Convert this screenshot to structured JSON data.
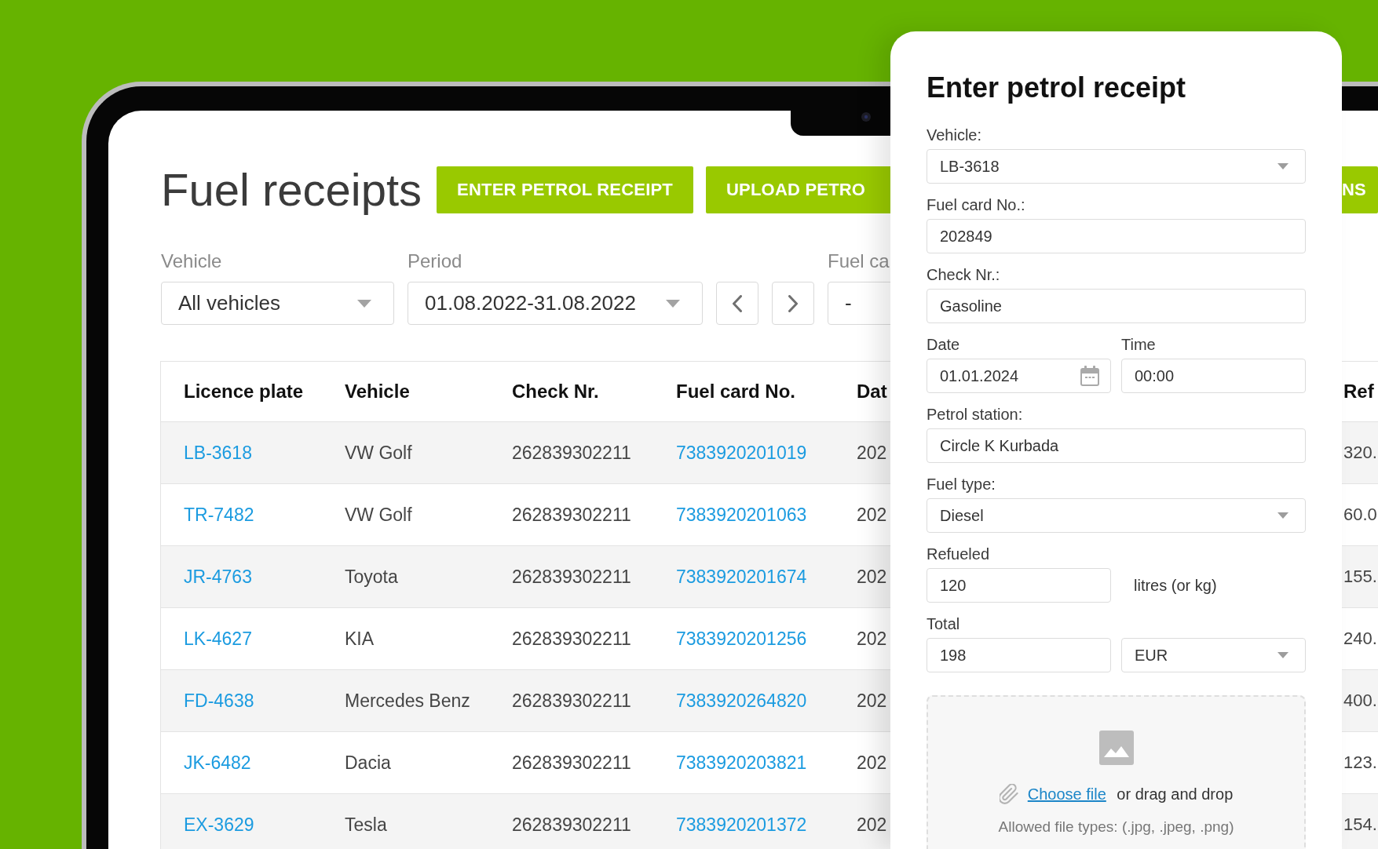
{
  "header": {
    "title": "Fuel receipts",
    "buttons": [
      {
        "label_parts": [
          "ENTER PETROL RECEIPT"
        ]
      },
      {
        "label_parts": [
          "UPLOAD PETRO",
          "NS"
        ]
      }
    ]
  },
  "filters": [
    {
      "kind": "select",
      "label": "Vehicle",
      "value": "All vehicles"
    },
    {
      "kind": "select",
      "label": "Period",
      "value": "01.08.2022-31.08.2022"
    },
    {
      "kind": "pager"
    },
    {
      "kind": "input",
      "label": "Fuel ca",
      "value": "-"
    }
  ],
  "table": {
    "columns": [
      {
        "label": "Licence plate",
        "kind": "link"
      },
      {
        "label": "Vehicle",
        "kind": "text"
      },
      {
        "label": "Check Nr.",
        "kind": "text"
      },
      {
        "label": "Fuel card No.",
        "kind": "link"
      },
      {
        "label": "Dat",
        "kind": "text"
      },
      {
        "label": "Ref",
        "kind": "text"
      }
    ],
    "rows": [
      {
        "cells": [
          "LB-3618",
          "VW Golf",
          "262839302211",
          "7383920201019",
          "202",
          "320."
        ]
      },
      {
        "cells": [
          "TR-7482",
          "VW Golf",
          "262839302211",
          "7383920201063",
          "202",
          "60.0"
        ]
      },
      {
        "cells": [
          "JR-4763",
          "Toyota",
          "262839302211",
          "7383920201674",
          "202",
          "155."
        ]
      },
      {
        "cells": [
          "LK-4627",
          "KIA",
          "262839302211",
          "7383920201256",
          "202",
          "240."
        ]
      },
      {
        "cells": [
          "FD-4638",
          "Mercedes Benz",
          "262839302211",
          "7383920264820",
          "202",
          "400."
        ]
      },
      {
        "cells": [
          "JK-6482",
          "Dacia",
          "262839302211",
          "7383920203821",
          "202",
          "123."
        ]
      },
      {
        "cells": [
          "EX-3629",
          "Tesla",
          "262839302211",
          "7383920201372",
          "202",
          "154."
        ]
      }
    ]
  },
  "receipt_form": {
    "title": "Enter petrol receipt",
    "rows": [
      {
        "fields": [
          {
            "kind": "select",
            "label": "Vehicle:",
            "value": "LB-3618"
          }
        ]
      },
      {
        "fields": [
          {
            "kind": "input",
            "label": "Fuel card No.:",
            "value": "202849"
          }
        ]
      },
      {
        "fields": [
          {
            "kind": "input",
            "label": "Check Nr.:",
            "value": "Gasoline"
          }
        ]
      },
      {
        "fields": [
          {
            "kind": "date",
            "label": "Date",
            "value": "01.01.2024"
          },
          {
            "kind": "input",
            "label": "Time",
            "value": "00:00"
          }
        ]
      },
      {
        "fields": [
          {
            "kind": "input",
            "label": "Petrol station:",
            "value": "Circle K Kurbada"
          }
        ]
      },
      {
        "fields": [
          {
            "kind": "select",
            "label": "Fuel type:",
            "value": "Diesel"
          }
        ]
      },
      {
        "label": "Refueled",
        "fields": [
          {
            "kind": "input",
            "value": "120"
          },
          {
            "kind": "unit",
            "text": "litres (or kg)"
          }
        ]
      },
      {
        "label": "Total",
        "fields": [
          {
            "kind": "input",
            "value": "198"
          },
          {
            "kind": "select",
            "value": "EUR"
          }
        ]
      }
    ],
    "upload": {
      "link": "Choose file",
      "prompt": "or drag and drop",
      "note": "Allowed file types: (.jpg, .jpeg, .png)"
    }
  }
}
